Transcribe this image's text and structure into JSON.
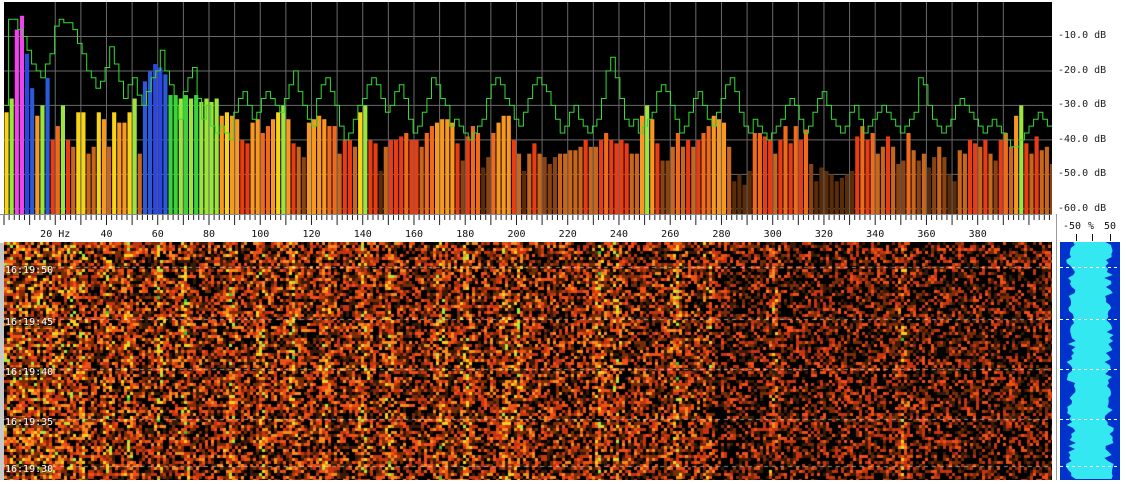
{
  "spectrum": {
    "db_labels": [
      "-10.0 dB",
      "-20.0 dB",
      "-30.0 dB",
      "-40.0 dB",
      "-50.0 dB",
      "-60.0 dB"
    ],
    "db_values": [
      -10,
      -20,
      -30,
      -40,
      -50,
      -60
    ],
    "db_range": [
      -61.5,
      0
    ],
    "freq_range_hz": [
      0,
      409
    ],
    "bar_width_hz": 2,
    "bar_levels_db": [
      -32,
      -28,
      -8,
      -4,
      -15,
      -25,
      -33,
      -30,
      -22,
      -40,
      -36,
      -30,
      -40,
      -42,
      -32,
      -32,
      -44,
      -42,
      -32,
      -34,
      -42,
      -32,
      -35,
      -35,
      -32,
      -28,
      -44,
      -23,
      -20,
      -18,
      -19,
      -21,
      -27,
      -27,
      -28,
      -27,
      -28,
      -27,
      -29,
      -28,
      -29,
      -28,
      -33,
      -32,
      -33,
      -34,
      -40,
      -41,
      -35,
      -34,
      -38,
      -36,
      -34,
      -32,
      -30,
      -34,
      -41,
      -42,
      -45,
      -35,
      -34,
      -33,
      -34,
      -36,
      -36,
      -44,
      -40,
      -40,
      -42,
      -32,
      -30,
      -40,
      -41,
      -49,
      -42,
      -40,
      -40,
      -39,
      -38,
      -40,
      -40,
      -42,
      -38,
      -36,
      -35,
      -34,
      -34,
      -35,
      -41,
      -46,
      -39,
      -36,
      -38,
      -48,
      -45,
      -38,
      -35,
      -33,
      -33,
      -40,
      -44,
      -49,
      -44,
      -41,
      -44,
      -45,
      -47,
      -45,
      -44,
      -44,
      -43,
      -43,
      -42,
      -40,
      -42,
      -42,
      -40,
      -38,
      -40,
      -41,
      -40,
      -41,
      -44,
      -44,
      -33,
      -30,
      -34,
      -41,
      -46,
      -46,
      -42,
      -38,
      -42,
      -40,
      -42,
      -40,
      -38,
      -36,
      -33,
      -34,
      -35,
      -42,
      -52,
      -50,
      -53,
      -49,
      -38,
      -38,
      -39,
      -40,
      -44,
      -40,
      -36,
      -41,
      -36,
      -40,
      -37,
      -47,
      -52,
      -48,
      -49,
      -50,
      -52,
      -51,
      -50,
      -49,
      -39,
      -36,
      -40,
      -38,
      -44,
      -42,
      -39,
      -42,
      -47,
      -46,
      -38,
      -43,
      -46,
      -44,
      -48,
      -45,
      -42,
      -45,
      -50,
      -52,
      -43,
      -44,
      -40,
      -41,
      -42,
      -40,
      -44,
      -46,
      -40,
      -38,
      -42,
      -33,
      -30,
      -41,
      -44,
      -39,
      -43,
      -42,
      -47,
      -41,
      -42,
      -49,
      -43,
      -44,
      -41,
      -46,
      -48,
      -42,
      -49,
      -44,
      -46,
      -48,
      -50,
      -51,
      -52,
      -50,
      -45,
      -43,
      -44,
      -46,
      -42,
      -42,
      -44
    ],
    "envelope_db": [
      -30,
      -5,
      -5,
      -8,
      -10,
      -14,
      -18,
      -20,
      -22,
      -18,
      -15,
      -7,
      -5,
      -6,
      -6,
      -8,
      -12,
      -15,
      -20,
      -22,
      -25,
      -23,
      -19,
      -13,
      -18,
      -23,
      -28,
      -24,
      -22,
      -27,
      -30,
      -26,
      -22,
      -20,
      -14,
      -20,
      -24,
      -30,
      -34,
      -26,
      -22,
      -19,
      -28,
      -34,
      -30,
      -36,
      -38,
      -36,
      -38,
      -40,
      -32,
      -28,
      -26,
      -30,
      -34,
      -32,
      -28,
      -26,
      -28,
      -30,
      -32,
      -28,
      -24,
      -20,
      -26,
      -30,
      -34,
      -36,
      -28,
      -24,
      -22,
      -26,
      -30,
      -36,
      -40,
      -38,
      -34,
      -30,
      -28,
      -24,
      -22,
      -24,
      -28,
      -32,
      -30,
      -26,
      -24,
      -28,
      -34,
      -38,
      -36,
      -32,
      -28,
      -22,
      -24,
      -28,
      -30,
      -36,
      -34,
      -36,
      -38,
      -40,
      -38,
      -36,
      -34,
      -28,
      -24,
      -22,
      -24,
      -28,
      -30,
      -34,
      -36,
      -32,
      -28,
      -24,
      -22,
      -24,
      -26,
      -30,
      -34,
      -38,
      -36,
      -32,
      -30,
      -34,
      -36,
      -38,
      -36,
      -34,
      -28,
      -20,
      -16,
      -22,
      -28,
      -34,
      -36,
      -34,
      -38,
      -36,
      -34,
      -32,
      -26,
      -24,
      -26,
      -30,
      -34,
      -38,
      -36,
      -32,
      -28,
      -26,
      -30,
      -34,
      -36,
      -32,
      -28,
      -24,
      -22,
      -26,
      -32,
      -36,
      -38,
      -34,
      -36,
      -38,
      -40,
      -38,
      -36,
      -34,
      -30,
      -28,
      -30,
      -34,
      -38,
      -36,
      -32,
      -28,
      -26,
      -30,
      -34,
      -36,
      -38,
      -36,
      -32,
      -30,
      -34,
      -38,
      -36,
      -34,
      -32,
      -30,
      -32,
      -34,
      -36,
      -38,
      -36,
      -34,
      -32,
      -22,
      -24,
      -30,
      -34,
      -36,
      -38,
      -36,
      -34,
      -30,
      -28,
      -30,
      -32,
      -34,
      -36,
      -38,
      -36,
      -34,
      -36,
      -38,
      -40,
      -42,
      -42,
      -40,
      -38,
      -36,
      -34,
      -32,
      -34,
      -36
    ],
    "envelope_color": "#33dd33",
    "background_color": "#000000"
  },
  "frequency_axis": {
    "labels": [
      "20 Hz",
      "40",
      "60",
      "80",
      "100",
      "120",
      "140",
      "160",
      "180",
      "200",
      "220",
      "240",
      "260",
      "280",
      "300",
      "320",
      "340",
      "360",
      "380"
    ],
    "values": [
      20,
      40,
      60,
      80,
      100,
      120,
      140,
      160,
      180,
      200,
      220,
      240,
      260,
      280,
      300,
      320,
      340,
      360,
      380
    ]
  },
  "level_meter": {
    "labels": [
      "-50",
      "%",
      "50"
    ],
    "fill_color": "#33e8f0",
    "background_color": "#0033cc"
  },
  "waterfall": {
    "time_labels": [
      "16:19:50",
      "16:19:45",
      "16:19:40",
      "16:19:35",
      "16:19:30"
    ],
    "time_fractions": [
      0.12,
      0.34,
      0.55,
      0.76,
      0.96
    ],
    "strong_lines_hz": [
      30,
      40,
      48,
      60,
      70,
      88,
      100,
      112,
      125,
      140,
      150,
      170,
      180,
      195,
      200,
      232,
      238,
      262,
      275,
      300,
      350
    ],
    "palette": [
      "#000000",
      "#3a1a06",
      "#7a2c06",
      "#c83410",
      "#f05014",
      "#f88c1c",
      "#f8d01c",
      "#a8e83c",
      "#30c838",
      "#1c50e8",
      "#e838e8"
    ]
  }
}
